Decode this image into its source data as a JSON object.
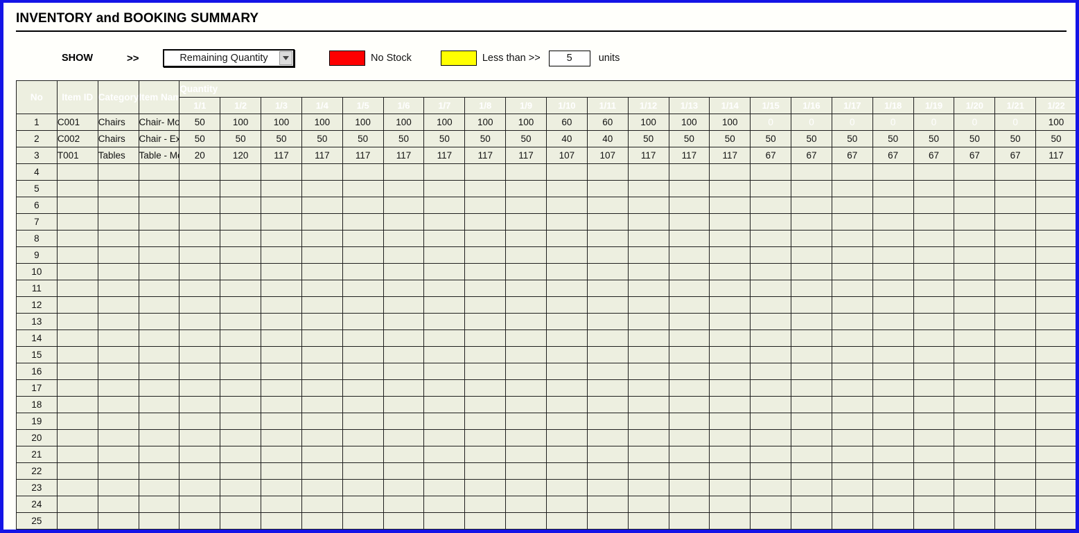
{
  "window": {
    "border_color": "#1414e6"
  },
  "header": {
    "title": "INVENTORY and BOOKING SUMMARY"
  },
  "toolbar": {
    "show_label": "SHOW",
    "arrows": ">>",
    "dropdown": {
      "name": "show-selector",
      "value": "Remaining Quantity",
      "arrow_icon": "chevron-down-icon"
    },
    "legend": {
      "no_stock": {
        "label": "No Stock",
        "color": "#FE0000"
      },
      "less_than": {
        "label": "Less than >>",
        "color": "#FFFF00"
      },
      "threshold_value": "5",
      "units_label": "units"
    }
  },
  "table": {
    "group_header": "Quantity",
    "columns": [
      "No",
      "Item ID",
      "Category",
      "Item Name"
    ],
    "date_columns": [
      "1/1",
      "1/2",
      "1/3",
      "1/4",
      "1/5",
      "1/6",
      "1/7",
      "1/8",
      "1/9",
      "1/10",
      "1/11",
      "1/12",
      "1/13",
      "1/14",
      "1/15",
      "1/16",
      "1/17",
      "1/18",
      "1/19",
      "1/20",
      "1/21",
      "1/22"
    ],
    "rows": [
      {
        "no": "1",
        "item_id": "C001",
        "category": "Chairs",
        "item_name": "Chair- Moderate",
        "quantities": [
          "50",
          "100",
          "100",
          "100",
          "100",
          "100",
          "100",
          "100",
          "100",
          "60",
          "60",
          "100",
          "100",
          "100",
          "0",
          "0",
          "0",
          "0",
          "0",
          "0",
          "0",
          "100"
        ],
        "nostock_flags": [
          false,
          false,
          false,
          false,
          false,
          false,
          false,
          false,
          false,
          false,
          false,
          false,
          false,
          false,
          true,
          true,
          true,
          true,
          true,
          true,
          true,
          false
        ]
      },
      {
        "no": "2",
        "item_id": "C002",
        "category": "Chairs",
        "item_name": "Chair - Expensive",
        "quantities": [
          "50",
          "50",
          "50",
          "50",
          "50",
          "50",
          "50",
          "50",
          "50",
          "40",
          "40",
          "50",
          "50",
          "50",
          "50",
          "50",
          "50",
          "50",
          "50",
          "50",
          "50",
          "50"
        ],
        "nostock_flags": [
          false,
          false,
          false,
          false,
          false,
          false,
          false,
          false,
          false,
          false,
          false,
          false,
          false,
          false,
          false,
          false,
          false,
          false,
          false,
          false,
          false,
          false
        ]
      },
      {
        "no": "3",
        "item_id": "T001",
        "category": "Tables",
        "item_name": "Table - Moderate",
        "quantities": [
          "20",
          "120",
          "117",
          "117",
          "117",
          "117",
          "117",
          "117",
          "117",
          "107",
          "107",
          "117",
          "117",
          "117",
          "67",
          "67",
          "67",
          "67",
          "67",
          "67",
          "67",
          "117"
        ],
        "nostock_flags": [
          false,
          false,
          false,
          false,
          false,
          false,
          false,
          false,
          false,
          false,
          false,
          false,
          false,
          false,
          false,
          false,
          false,
          false,
          false,
          false,
          false,
          false
        ]
      },
      {
        "no": "4",
        "item_id": "",
        "category": "",
        "item_name": "",
        "quantities": [],
        "nostock_flags": []
      },
      {
        "no": "5",
        "item_id": "",
        "category": "",
        "item_name": "",
        "quantities": [],
        "nostock_flags": []
      },
      {
        "no": "6",
        "item_id": "",
        "category": "",
        "item_name": "",
        "quantities": [],
        "nostock_flags": []
      },
      {
        "no": "7",
        "item_id": "",
        "category": "",
        "item_name": "",
        "quantities": [],
        "nostock_flags": []
      },
      {
        "no": "8",
        "item_id": "",
        "category": "",
        "item_name": "",
        "quantities": [],
        "nostock_flags": []
      },
      {
        "no": "9",
        "item_id": "",
        "category": "",
        "item_name": "",
        "quantities": [],
        "nostock_flags": []
      },
      {
        "no": "10",
        "item_id": "",
        "category": "",
        "item_name": "",
        "quantities": [],
        "nostock_flags": []
      },
      {
        "no": "11",
        "item_id": "",
        "category": "",
        "item_name": "",
        "quantities": [],
        "nostock_flags": []
      },
      {
        "no": "12",
        "item_id": "",
        "category": "",
        "item_name": "",
        "quantities": [],
        "nostock_flags": []
      },
      {
        "no": "13",
        "item_id": "",
        "category": "",
        "item_name": "",
        "quantities": [],
        "nostock_flags": []
      },
      {
        "no": "14",
        "item_id": "",
        "category": "",
        "item_name": "",
        "quantities": [],
        "nostock_flags": []
      },
      {
        "no": "15",
        "item_id": "",
        "category": "",
        "item_name": "",
        "quantities": [],
        "nostock_flags": []
      },
      {
        "no": "16",
        "item_id": "",
        "category": "",
        "item_name": "",
        "quantities": [],
        "nostock_flags": []
      },
      {
        "no": "17",
        "item_id": "",
        "category": "",
        "item_name": "",
        "quantities": [],
        "nostock_flags": []
      },
      {
        "no": "18",
        "item_id": "",
        "category": "",
        "item_name": "",
        "quantities": [],
        "nostock_flags": []
      },
      {
        "no": "19",
        "item_id": "",
        "category": "",
        "item_name": "",
        "quantities": [],
        "nostock_flags": []
      },
      {
        "no": "20",
        "item_id": "",
        "category": "",
        "item_name": "",
        "quantities": [],
        "nostock_flags": []
      },
      {
        "no": "21",
        "item_id": "",
        "category": "",
        "item_name": "",
        "quantities": [],
        "nostock_flags": []
      },
      {
        "no": "22",
        "item_id": "",
        "category": "",
        "item_name": "",
        "quantities": [],
        "nostock_flags": []
      },
      {
        "no": "23",
        "item_id": "",
        "category": "",
        "item_name": "",
        "quantities": [],
        "nostock_flags": []
      },
      {
        "no": "24",
        "item_id": "",
        "category": "",
        "item_name": "",
        "quantities": [],
        "nostock_flags": []
      },
      {
        "no": "25",
        "item_id": "",
        "category": "",
        "item_name": "",
        "quantities": [],
        "nostock_flags": []
      }
    ]
  }
}
